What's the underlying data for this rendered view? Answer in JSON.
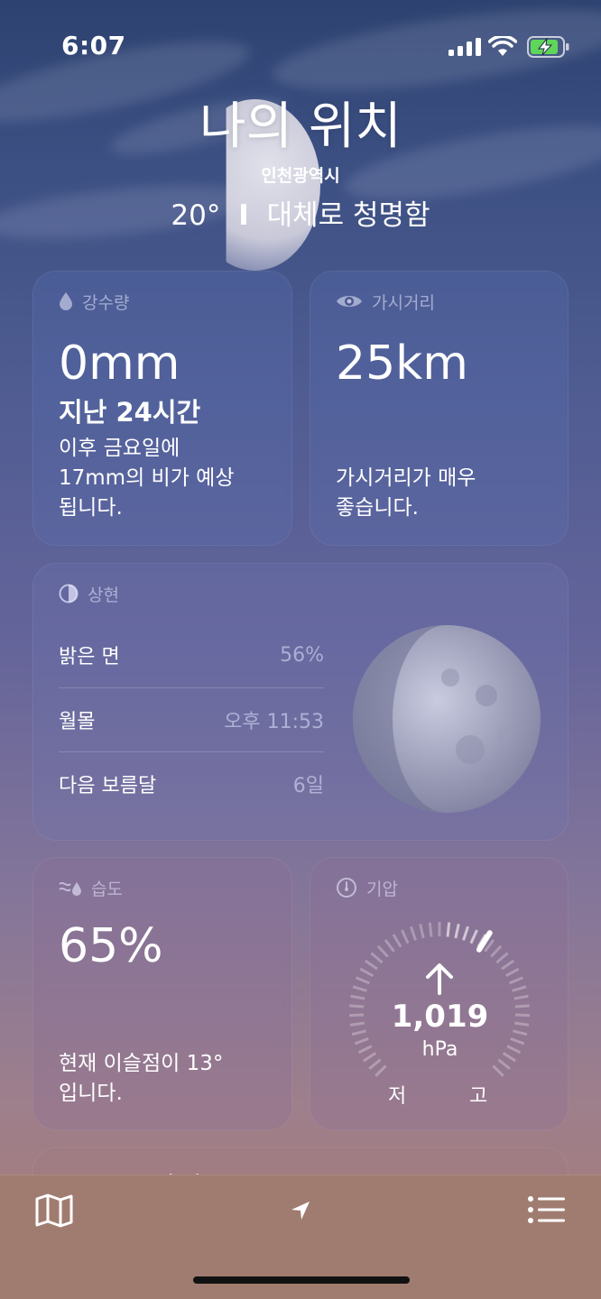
{
  "status_bar": {
    "time": "6:07"
  },
  "header": {
    "location_title": "나의 위치",
    "city": "인천광역시",
    "temperature": "20°",
    "separator": "I",
    "condition": "대체로 청명함"
  },
  "precipitation": {
    "title": "강수량",
    "icon": "raindrop-icon",
    "value": "0mm",
    "period": "지난 24시간",
    "forecast": [
      "이후 금요일에",
      "17mm의 비가 예상",
      "됩니다."
    ]
  },
  "visibility": {
    "title": "가시거리",
    "icon": "eye-icon",
    "value": "25km",
    "description": [
      "가시거리가 매우",
      "좋습니다."
    ]
  },
  "moon": {
    "title": "상현",
    "icon": "half-moon-icon",
    "rows": [
      {
        "label": "밝은 면",
        "value": "56%"
      },
      {
        "label": "월몰",
        "value": "오후 11:53"
      },
      {
        "label": "다음 보름달",
        "value": "6일"
      }
    ]
  },
  "humidity": {
    "title": "습도",
    "icon": "humidity-icon",
    "value": "65%",
    "description": [
      "현재 이슬점이 13°",
      "입니다."
    ]
  },
  "pressure": {
    "title": "기압",
    "icon": "gauge-icon",
    "value": "1,019",
    "unit": "hPa",
    "low_label": "저",
    "high_label": "고",
    "trend": "rising",
    "gauge_level": 0.62
  },
  "next_card": {
    "title_partial": "공기 질"
  },
  "tabbar": {
    "map_icon": "map-icon",
    "location_icon": "location-arrow-icon",
    "list_icon": "list-icon"
  }
}
